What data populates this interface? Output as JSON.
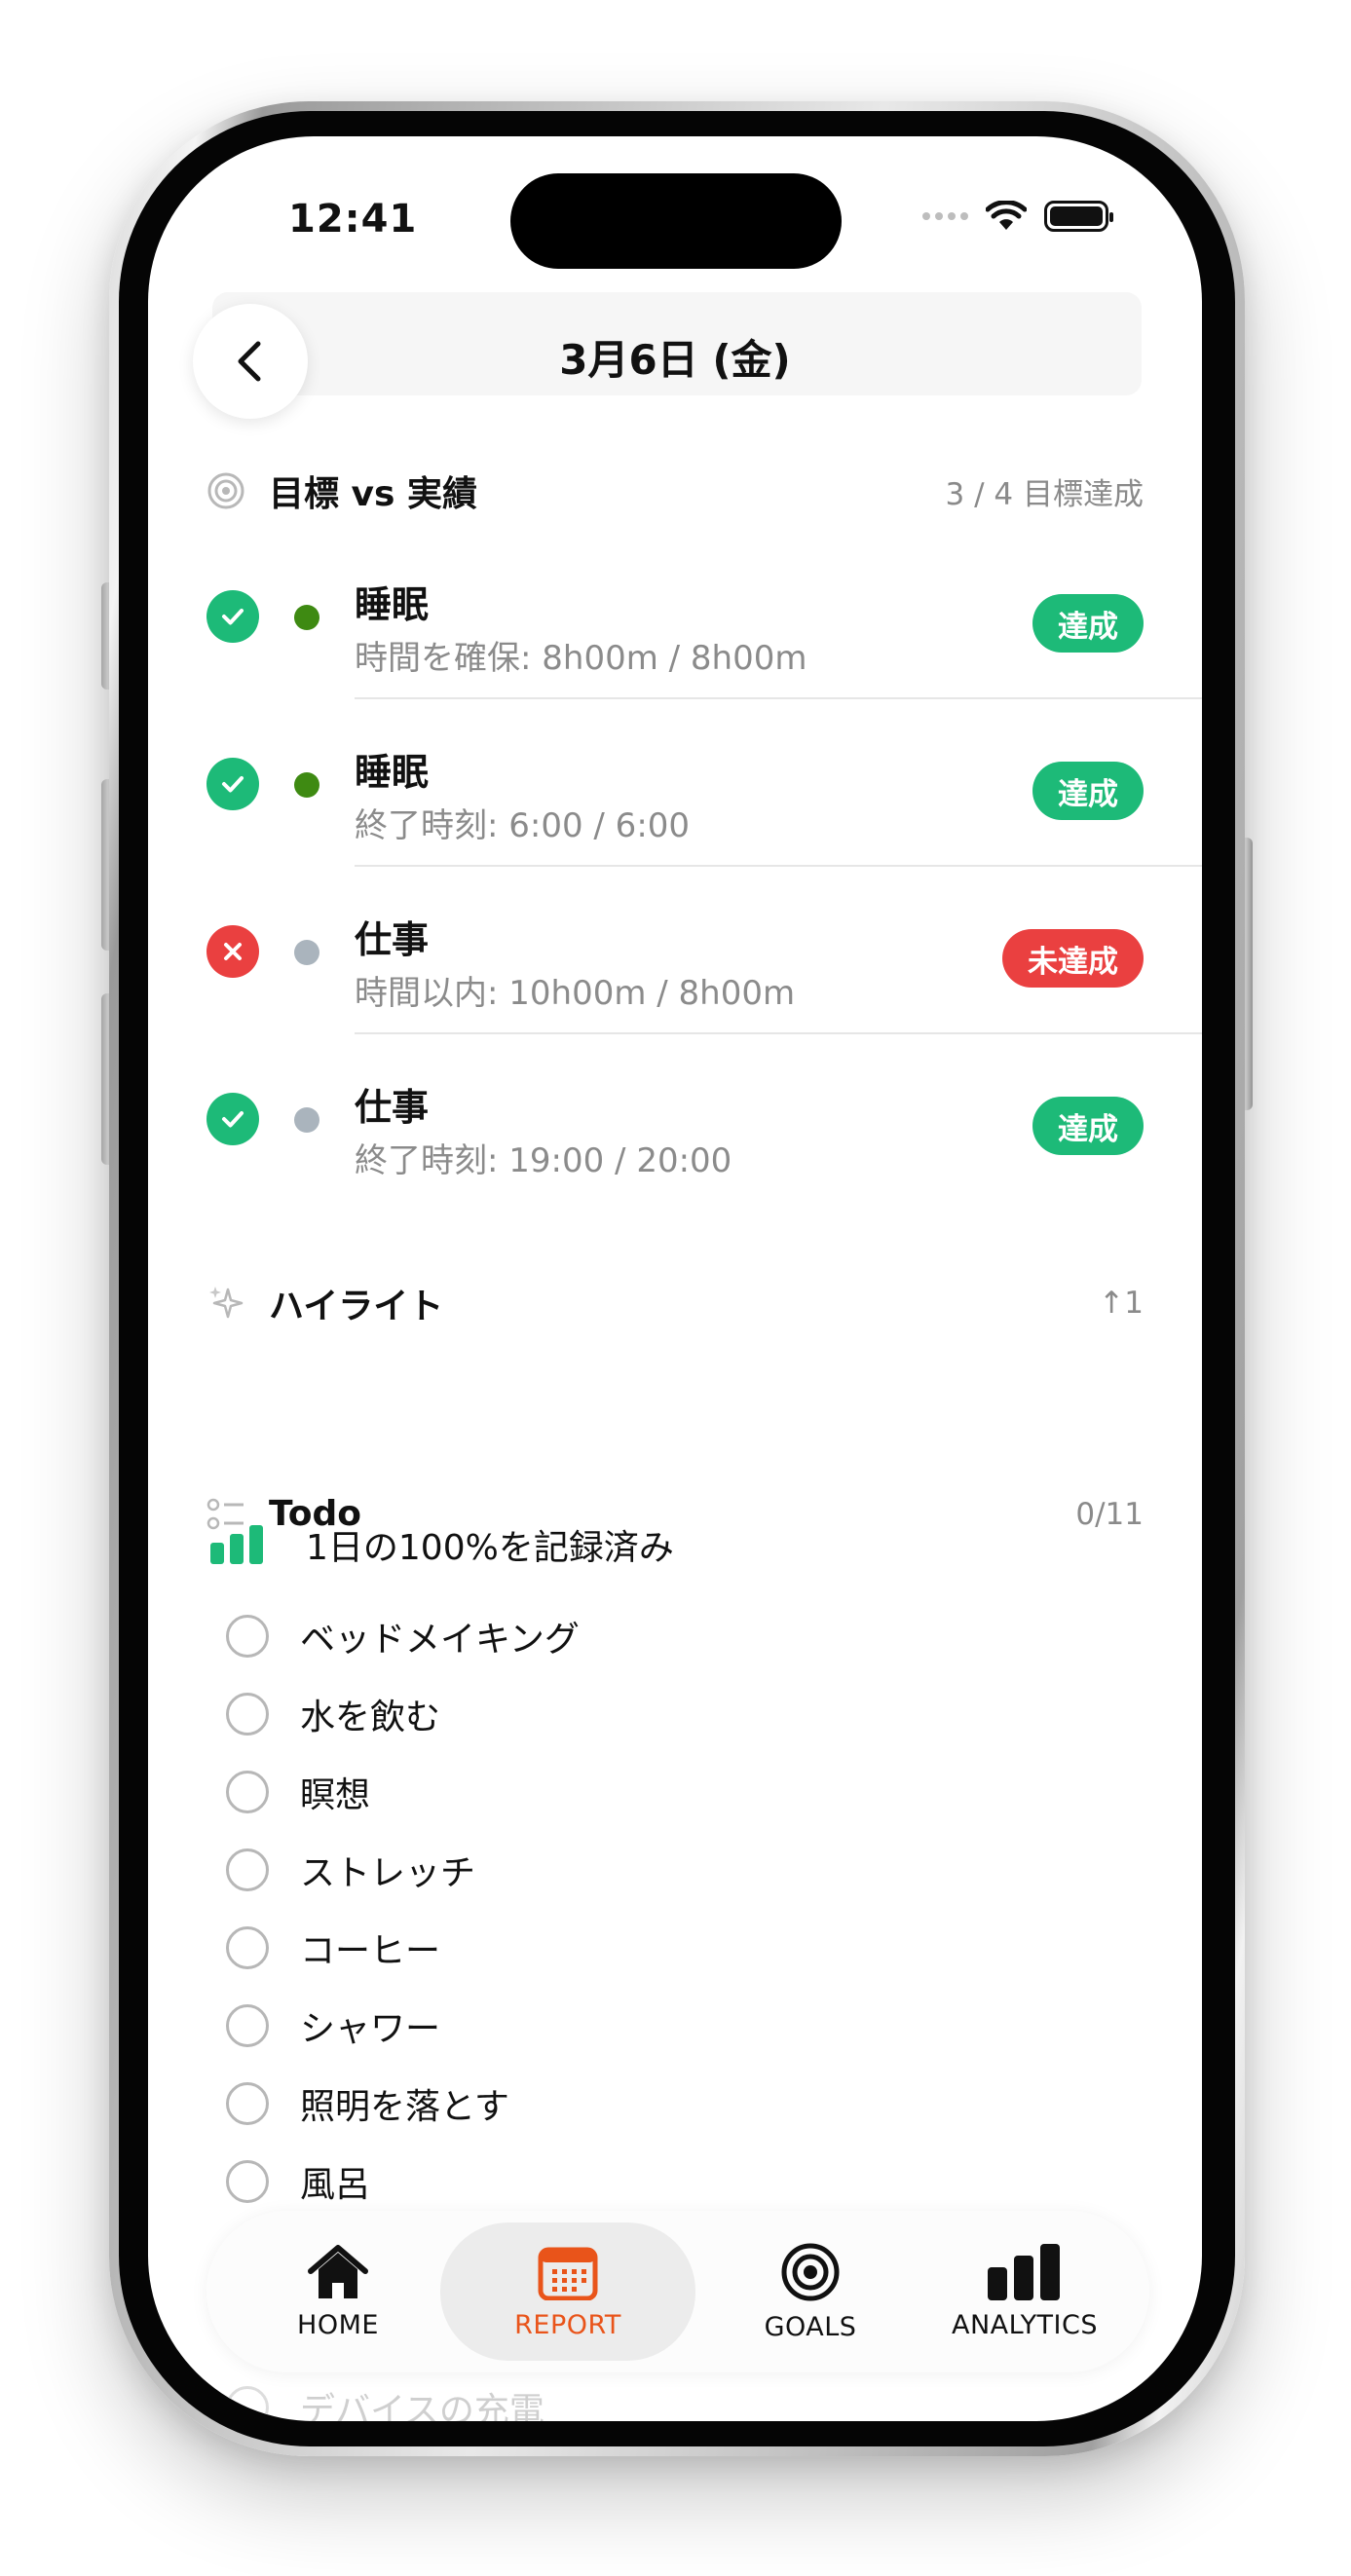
{
  "status_bar": {
    "time": "12:41"
  },
  "header": {
    "title": "3月6日 (金)"
  },
  "goals": {
    "title": "目標 vs 実績",
    "summary": "3 / 4 目標達成",
    "items": [
      {
        "title": "睡眠",
        "detail": "時間を確保: 8h00m / 8h00m",
        "status": "達成",
        "achieved": true,
        "dot_color": "#3e8a12"
      },
      {
        "title": "睡眠",
        "detail": "終了時刻: 6:00 / 6:00",
        "status": "達成",
        "achieved": true,
        "dot_color": "#3e8a12"
      },
      {
        "title": "仕事",
        "detail": "時間以内: 10h00m / 8h00m",
        "status": "未達成",
        "achieved": false,
        "dot_color": "#aab4bd"
      },
      {
        "title": "仕事",
        "detail": "終了時刻: 19:00 / 20:00",
        "status": "達成",
        "achieved": true,
        "dot_color": "#aab4bd"
      }
    ]
  },
  "highlights": {
    "title": "ハイライト",
    "count": "↑1",
    "item": "1日の100%を記録済み"
  },
  "todo": {
    "title": "Todo",
    "count": "0/11",
    "items": [
      "ベッドメイキング",
      "水を飲む",
      "瞑想",
      "ストレッチ",
      "コーヒー",
      "シャワー",
      "照明を落とす",
      "風呂",
      "デバイスの充電"
    ]
  },
  "tabbar": {
    "tabs": [
      {
        "label": "HOME",
        "icon": "home-icon"
      },
      {
        "label": "REPORT",
        "icon": "calendar-icon",
        "active": true
      },
      {
        "label": "GOALS",
        "icon": "target-icon"
      },
      {
        "label": "ANALYTICS",
        "icon": "bar-chart-icon"
      }
    ]
  },
  "colors": {
    "success": "#1dba78",
    "failure": "#ea4040",
    "accent": "#e9541a"
  }
}
